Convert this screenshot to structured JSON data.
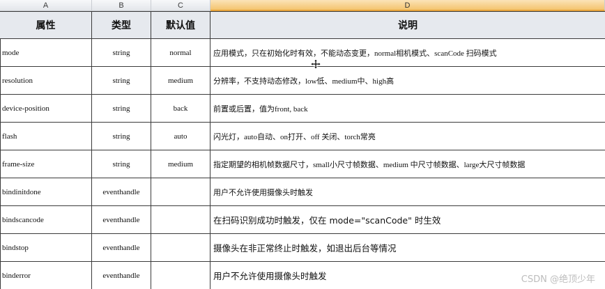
{
  "columns": [
    "A",
    "B",
    "C",
    "D"
  ],
  "header": {
    "attr": "属性",
    "type": "类型",
    "default": "默认值",
    "desc": "说明"
  },
  "rows": [
    {
      "attr": "mode",
      "type": "string",
      "default": "normal",
      "desc": "应用模式，只在初始化时有效，不能动态变更，normal相机模式、scanCode 扫码模式"
    },
    {
      "attr": "resolution",
      "type": "string",
      "default": "medium",
      "desc": "分辨率，不支持动态修改，low低、medium中、high高"
    },
    {
      "attr": "device-position",
      "type": "string",
      "default": "back",
      "desc": "前置或后置，值为front, back"
    },
    {
      "attr": "flash",
      "type": "string",
      "default": "auto",
      "desc": "闪光灯，auto自动、on打开、off 关闭、torch常亮"
    },
    {
      "attr": "frame-size",
      "type": "string",
      "default": "medium",
      "desc": "指定期望的相机帧数据尺寸，small小尺寸帧数据、medium 中尺寸帧数据、large大尺寸帧数据"
    },
    {
      "attr": "bindinitdone",
      "type": "eventhandle",
      "default": "",
      "desc": "用户不允许使用摄像头时触发"
    },
    {
      "attr": "bindscancode",
      "type": "eventhandle",
      "default": "",
      "desc": "在扫码识别成功时触发，仅在 mode=\"scanCode\" 时生效"
    },
    {
      "attr": "bindstop",
      "type": "eventhandle",
      "default": "",
      "desc": "摄像头在非正常终止时触发，如退出后台等情况"
    },
    {
      "attr": "binderror",
      "type": "eventhandle",
      "default": "",
      "desc": "用户不允许使用摄像头时触发"
    }
  ],
  "watermark": "CSDN @绝顶少年",
  "colors": {
    "grid": "#3a3a3a",
    "header_bg": "#e6e9ee",
    "selected_col": "#f4c46e"
  },
  "cursor_icon": "move-cursor-icon"
}
